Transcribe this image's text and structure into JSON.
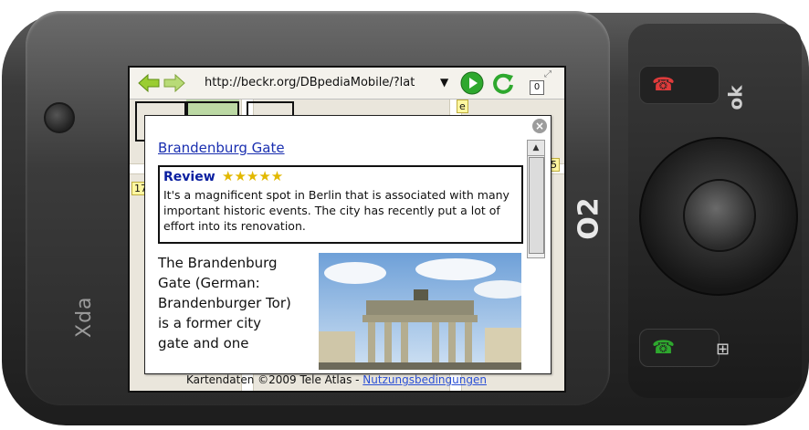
{
  "device": {
    "brand": "Xda",
    "carrier_logo": "O2",
    "ok_label": "ok"
  },
  "browser": {
    "url": "http://beckr.org/DBpediaMobile/?lat",
    "tab_count": "0"
  },
  "map": {
    "tags": [
      "17",
      "e",
      "5"
    ],
    "footer_text": "Kartendaten ©2009 Tele Atlas - ",
    "footer_link": "Nutzungsbedingungen"
  },
  "popup": {
    "title": "Brandenburg Gate",
    "review": {
      "heading": "Review",
      "rating": 5,
      "stars": "★★★★★",
      "text": "It's a magnificent spot in Berlin that is associated with many important historic events. The city has recently put a lot of effort into its renovation."
    },
    "body": "The Brandenburg Gate (German: Brandenburger Tor) is a former city gate and one"
  },
  "colors": {
    "link": "#1a2fb0",
    "review_heading": "#0a1fa0",
    "star": "#e2b800",
    "nav_arrow": "#9acd32",
    "go_button": "#2ea82e"
  }
}
